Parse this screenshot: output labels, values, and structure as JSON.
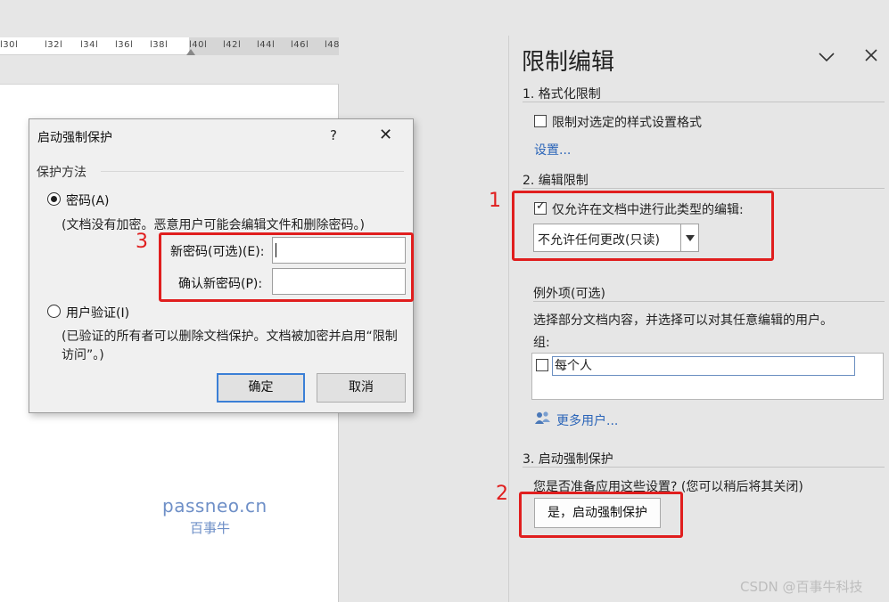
{
  "ruler": {
    "ticks": [
      "l30l",
      "l32l",
      "l34l",
      "l36l",
      "l38l",
      "l40l",
      "l42l",
      "l44l",
      "l46l",
      "l48"
    ]
  },
  "watermark": {
    "line1": "passneo.cn",
    "line2": "百事牛"
  },
  "dialog": {
    "title": "启动强制保护",
    "help": "?",
    "close": "✕",
    "group_label": "保护方法",
    "password_option": "密码(A)",
    "password_note": "(文档没有加密。恶意用户可能会编辑文件和删除密码。)",
    "new_password_label": "新密码(可选)(E):",
    "confirm_password_label": "确认新密码(P):",
    "new_password_value": "",
    "confirm_password_value": "",
    "user_auth_option": "用户验证(I)",
    "user_auth_note": "(已验证的所有者可以删除文档保护。文档被加密并启用“限制访问”。)",
    "ok": "确定",
    "cancel": "取消",
    "password_selected": true
  },
  "pane": {
    "title": "限制编辑",
    "section1": {
      "title": "1. 格式化限制",
      "checkbox_label": "限制对选定的样式设置格式",
      "checked": false,
      "settings_link": "设置..."
    },
    "section2": {
      "title": "2. 编辑限制",
      "checkbox_label": "仅允许在文档中进行此类型的编辑:",
      "checked": true,
      "select_value": "不允许任何更改(只读)",
      "exceptions_title": "例外项(可选)",
      "exceptions_desc": "选择部分文档内容，并选择可以对其任意编辑的用户。",
      "groups_label": "组:",
      "group_item": "每个人",
      "more_users_link": "更多用户..."
    },
    "section3": {
      "title": "3. 启动强制保护",
      "question": "您是否准备应用这些设置? (您可以稍后将其关闭)",
      "button": "是，启动强制保护"
    }
  },
  "annotations": {
    "n1": "1",
    "n2": "2",
    "n3": "3"
  },
  "footer": "CSDN @百事牛科技",
  "colors": {
    "highlight": "#e01e1e",
    "link": "#2a64b8",
    "ok_border": "#3b7fd6"
  },
  "icons": {
    "chevron": "chevron-down-icon",
    "close": "close-icon",
    "users": "users-icon"
  }
}
